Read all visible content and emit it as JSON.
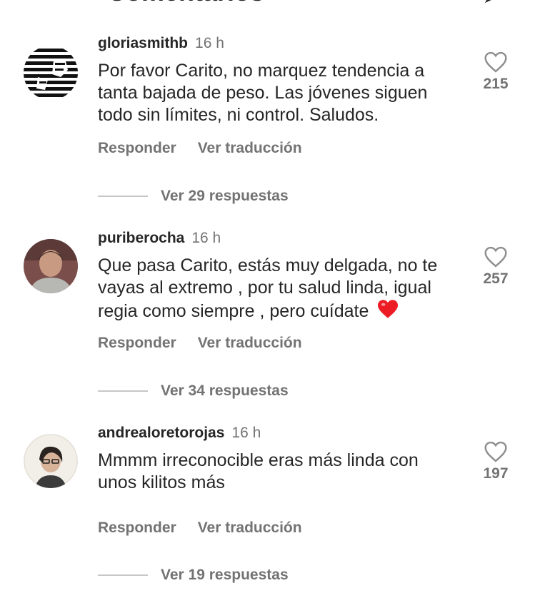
{
  "header": {
    "title": "Comentarios",
    "back_icon": "arrow-left-icon",
    "send_icon": "send-icon"
  },
  "comments": [
    {
      "username": "gloriasmithb",
      "time": "16 h",
      "text": "Por favor Carito, no marquez tendencia a tanta bajada de peso. Las jóvenes siguen todo sin límites, ni control. Saludos.",
      "likes": "215",
      "reply_label": "Responder",
      "translate_label": "Ver traducción",
      "view_replies": "Ver 29 respuestas"
    },
    {
      "username": "puriberocha",
      "time": "16 h",
      "text": "Que pasa Carito, estás muy delgada, no te vayas al extremo , por tu salud linda, igual regia como siempre , pero cuídate",
      "likes": "257",
      "reply_label": "Responder",
      "translate_label": "Ver traducción",
      "view_replies": "Ver 34 respuestas"
    },
    {
      "username": "andrealoretorojas",
      "time": "16 h",
      "text": "Mmmm irreconocible eras más linda con unos kilitos más",
      "likes": "197",
      "reply_label": "Responder",
      "translate_label": "Ver traducción",
      "view_replies": "Ver 19 respuestas"
    }
  ],
  "next_comment_peek": "",
  "colors": {
    "text": "#262626",
    "secondary": "#737373",
    "heart_red": "#ed1c24"
  }
}
